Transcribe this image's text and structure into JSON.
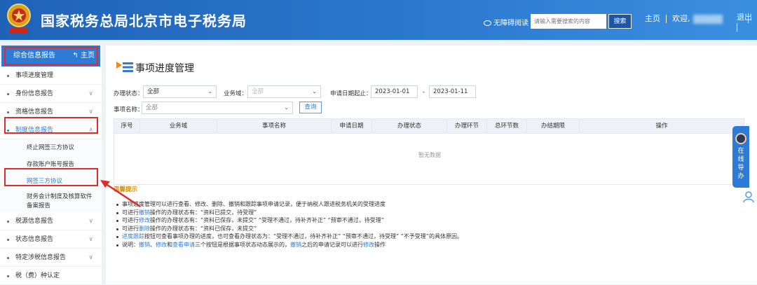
{
  "header": {
    "site_title": "国家税务总局北京市电子税务局",
    "accessibility_label": "无障碍阅读",
    "search_placeholder": "请输入需要搜索的内容",
    "search_button": "搜索",
    "home_link": "主页",
    "welcome_label": "欢迎,",
    "logout_label": "退出"
  },
  "sidebar": {
    "head_label": "综合信息报告",
    "head_home": "主页",
    "items": [
      {
        "label": "事项进度管理"
      },
      {
        "label": "身份信息报告"
      },
      {
        "label": "资格信息报告"
      },
      {
        "label": "制度信息报告"
      }
    ],
    "sub_items": [
      {
        "label": "终止网签三方协议"
      },
      {
        "label": "存款账户账号报告"
      },
      {
        "label": "网签三方协议"
      },
      {
        "label": "财务会计制度及核算软件备案报告"
      }
    ],
    "items_after": [
      {
        "label": "税源信息报告"
      },
      {
        "label": "状态信息报告"
      },
      {
        "label": "特定涉税信息报告"
      },
      {
        "label": "税（费）种认定"
      }
    ]
  },
  "main": {
    "title": "事项进度管理",
    "status_label": "办理状态：",
    "status_value": "全部",
    "domain_label": "业务域：",
    "domain_value": "全部",
    "date_label": "申请日期起止：",
    "date_start": "2023-01-01",
    "date_sep": "-",
    "date_end": "2023-01-11",
    "item_name_label": "事项名称：",
    "item_name_value": "全部",
    "query_button": "查询",
    "columns": [
      "序号",
      "业务域",
      "事项名称",
      "申请日期",
      "办理状态",
      "办理环节",
      "总环节数",
      "办结期限",
      "操作"
    ],
    "empty_text": "暂无数据",
    "tips_title": "温馨提示",
    "tips": [
      {
        "pre": "事项进度管理可以进行查看、修改、删除、撤销和跟踪事项申请记录，便于纳税人跟进税务机关的受理进度",
        "hl": "",
        "post": ""
      },
      {
        "pre": "可进行",
        "hl": "撤销",
        "post": "操作的办理状态有：“资料已提交，待受理”"
      },
      {
        "pre": "可进行",
        "hl": "修改",
        "post": "操作的办理状态有：“资料已保存，未提交” “受理不通过，待补齐补正” “预审不通过，待受理”"
      },
      {
        "pre": "可进行",
        "hl": "删除",
        "post": "操作的办理状态有：“资料已保存，未提交”"
      },
      {
        "pre": "",
        "hl": "进度跟踪",
        "post": "按钮可查看事项办理的进度，也可查看办理状态为：“受理不通过，待补齐补正” “预审不通过，待受理” “不予受理”的具体原因。"
      }
    ],
    "last_tip": {
      "p1": "说明：",
      "h1": "撤销",
      "p2": "、",
      "h2": "修改",
      "p3": "和",
      "h3": "查看申请",
      "p4": "三个按钮是根据事项状态动态展示的，",
      "h4": "撤销",
      "p5": "之后的申请记录可以进行",
      "h5": "修改",
      "p6": "操作"
    }
  },
  "float_panel": {
    "label_chars": [
      "在",
      "线",
      "导",
      "办"
    ]
  },
  "colors": {
    "header_blue": "#2b78cf",
    "accent_blue": "#2e7bd6",
    "highlight_red": "#e02b2b",
    "tip_orange": "#e08a00"
  }
}
